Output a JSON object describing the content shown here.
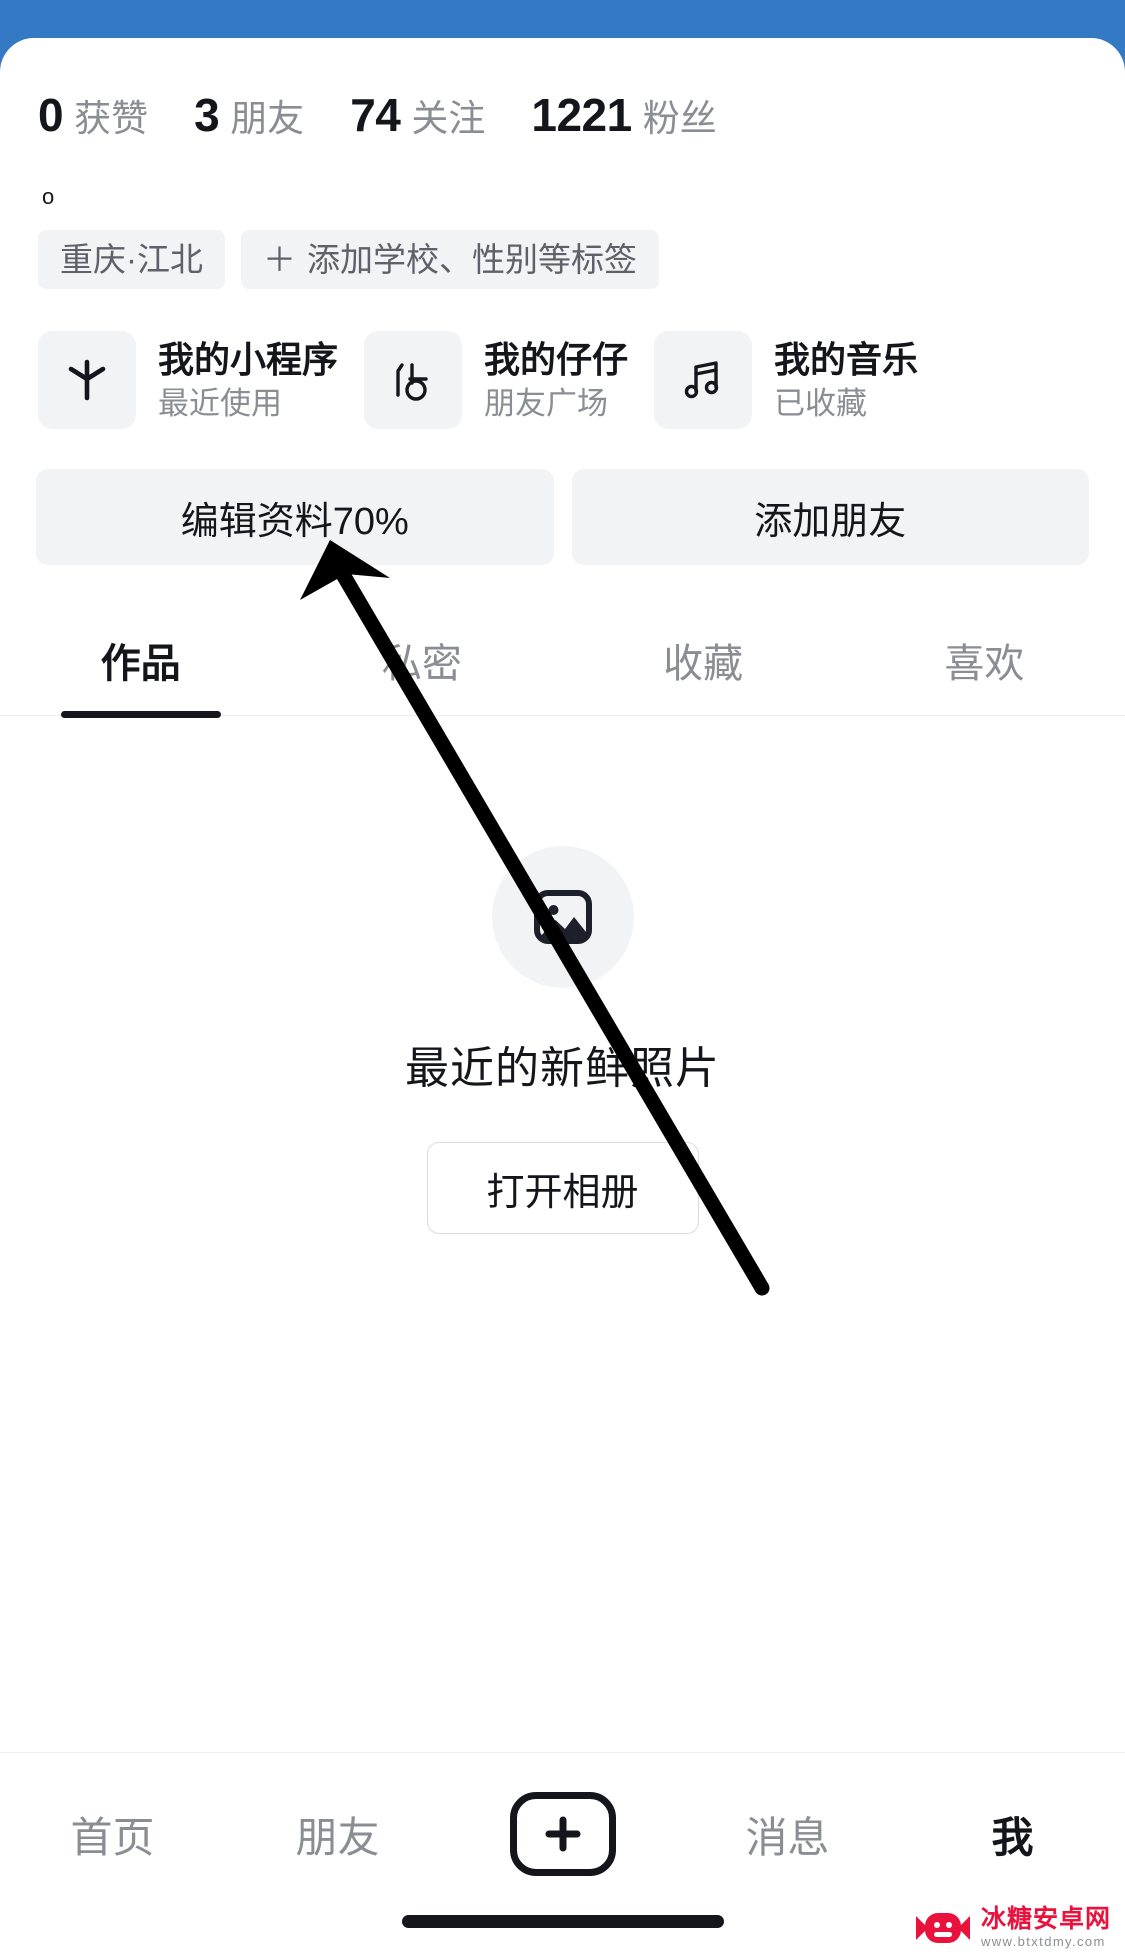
{
  "theme": {
    "status_bar_bg": "#3479c4",
    "sheet_bg": "#ffffff",
    "text_primary": "#14161c",
    "text_muted": "#8a8d94",
    "chip_bg": "#f2f3f5",
    "accent": "#14161c"
  },
  "profile": {
    "stats": [
      {
        "value": "0",
        "label": "获赞"
      },
      {
        "value": "3",
        "label": "朋友"
      },
      {
        "value": "74",
        "label": "关注"
      },
      {
        "value": "1221",
        "label": "粉丝"
      }
    ],
    "bio": "o",
    "tags": [
      {
        "icon": "",
        "label": "重庆·江北"
      },
      {
        "icon": "＋",
        "label": "添加学校、性别等标签"
      }
    ]
  },
  "quick_cards": [
    {
      "icon": "mini-program-icon",
      "title": "我的小程序",
      "subtitle": "最近使用"
    },
    {
      "icon": "zaizai-icon",
      "title": "我的仔仔",
      "subtitle": "朋友广场"
    },
    {
      "icon": "music-note-icon",
      "title": "我的音乐",
      "subtitle": "已收藏"
    }
  ],
  "actions": {
    "edit_profile": "编辑资料70%",
    "add_friend": "添加朋友"
  },
  "tabs": [
    {
      "label": "作品",
      "active": true
    },
    {
      "label": "私密",
      "active": false
    },
    {
      "label": "收藏",
      "active": false
    },
    {
      "label": "喜欢",
      "active": false
    }
  ],
  "empty_state": {
    "icon": "photo-icon",
    "title": "最近的新鲜照片",
    "button": "打开相册"
  },
  "bottom_nav": [
    {
      "label": "首页",
      "active": false
    },
    {
      "label": "朋友",
      "active": false
    },
    {
      "label": "",
      "active": false,
      "icon": "plus-icon"
    },
    {
      "label": "消息",
      "active": false
    },
    {
      "label": "我",
      "active": true
    }
  ],
  "watermark": {
    "name": "冰糖安卓网",
    "url": "www.btxtdmy.com"
  }
}
